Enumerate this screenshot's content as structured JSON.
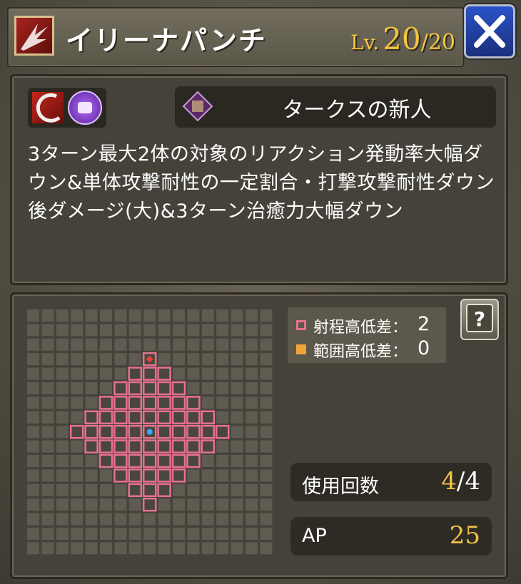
{
  "header": {
    "skill_name": "イリーナパンチ",
    "level_prefix": "Lv.",
    "level_current": "20",
    "level_separator": "/",
    "level_max": "20"
  },
  "info": {
    "title": "タークスの新人",
    "description": "3ターン最大2体の対象のリアクション発動率大幅ダウン&単体攻撃耐性の一定割合・打撃攻撃耐性ダウン後ダメージ(大)&3ターン治癒力大幅ダウン"
  },
  "range": {
    "range_height_label": "射程高低差：",
    "range_height_value": "2",
    "area_height_label": "範囲高低差：",
    "area_height_value": "0",
    "range_color": "#e8708e",
    "area_color": "#f2a43a",
    "target_color": "#e8403a",
    "center_color": "#3aa8ff",
    "help_icon_text": "?"
  },
  "stats": {
    "uses_label": "使用回数",
    "uses_current": "4",
    "uses_separator": "/",
    "uses_max": "4",
    "ap_label": "AP",
    "ap_value": "25"
  },
  "icons": {
    "skill_type": "fist-burst-icon",
    "attribute_1": "slash-icon",
    "attribute_2": "strike-fist-icon",
    "title_emblem": "turks-emblem-icon",
    "close": "close-icon",
    "help": "help-book-icon"
  }
}
